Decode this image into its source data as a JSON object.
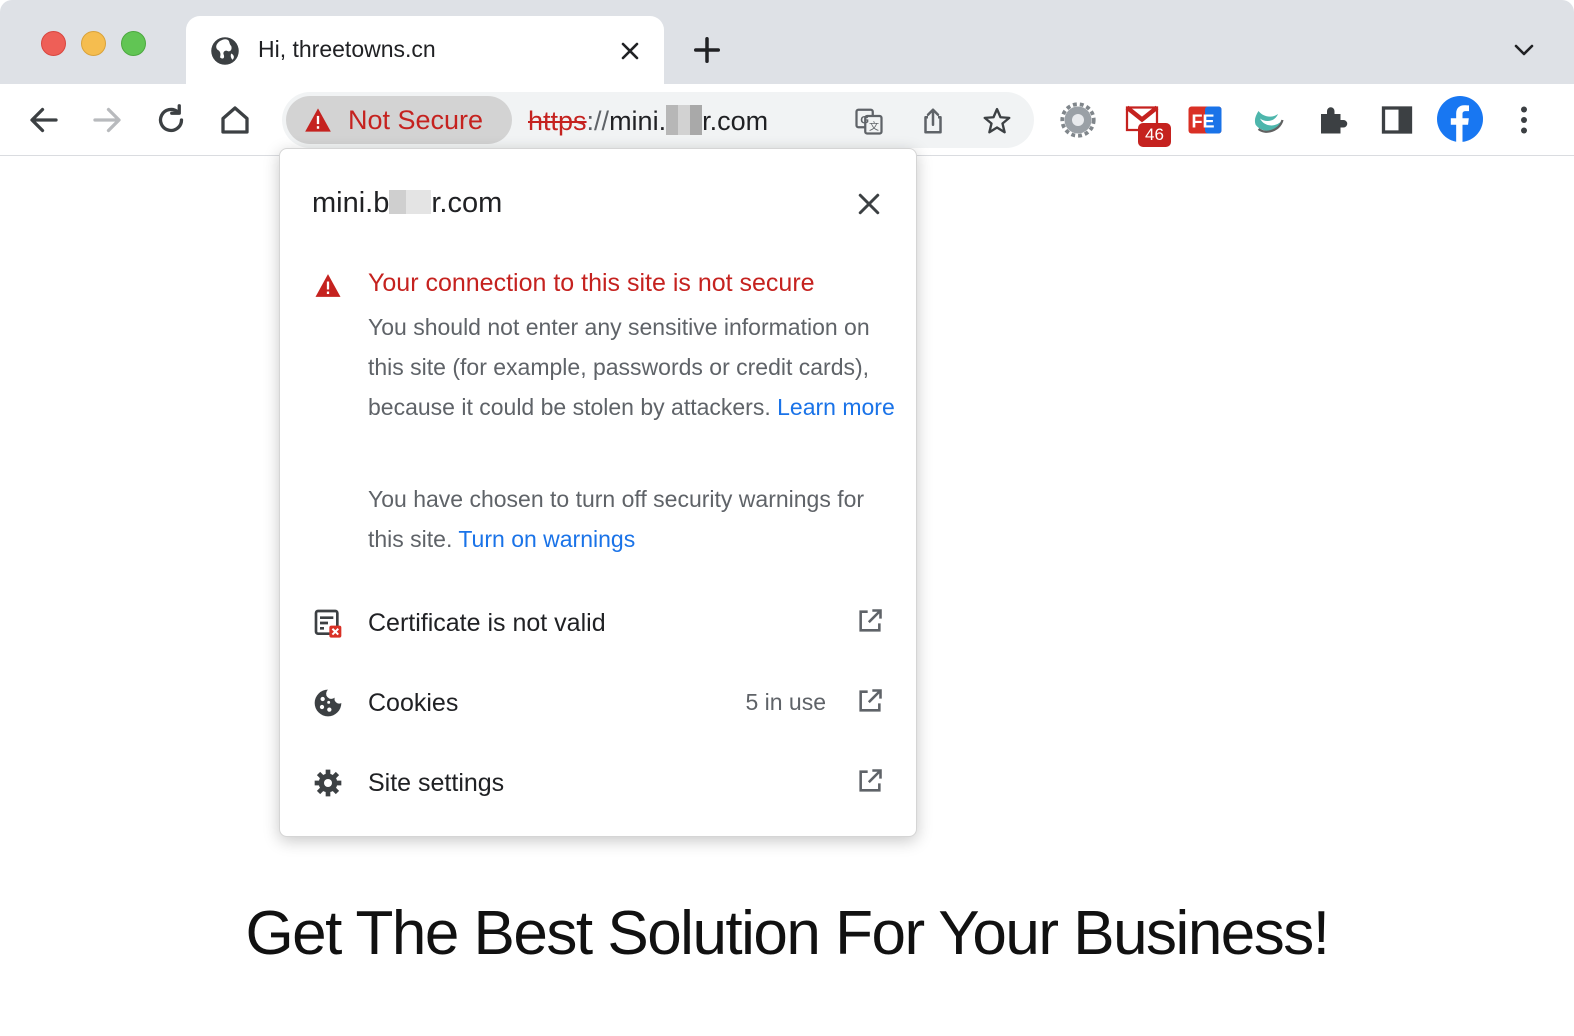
{
  "tab": {
    "title": "Hi, threetowns.cn"
  },
  "omnibox": {
    "security_label": "Not Secure",
    "url_scheme": "https",
    "url_separator": "://",
    "url_host_prefix": "mini.",
    "url_host_suffix": "r.com"
  },
  "extensions": {
    "mail_badge": "46"
  },
  "popup": {
    "site_prefix": "mini.b",
    "site_suffix": "r.com",
    "warning_title": "Your connection to this site is not secure",
    "warning_body": "You should not enter any sensitive information on this site (for example, passwords or credit cards), because it could be stolen by attackers.",
    "learn_more": "Learn more",
    "warnings_off_text": "You have chosen to turn off security warnings for this site.",
    "turn_on_warnings": "Turn on warnings",
    "rows": [
      {
        "label": "Certificate is not valid",
        "icon": "certificate-invalid-icon"
      },
      {
        "label": "Cookies",
        "count": "5 in use",
        "icon": "cookie-icon"
      },
      {
        "label": "Site settings",
        "icon": "gear-icon"
      }
    ]
  },
  "page": {
    "headline": "Get The Best Solution For Your Business!"
  },
  "colors": {
    "danger": "#c5221f",
    "link": "#1a73e8",
    "tabstrip": "#dee1e6"
  }
}
